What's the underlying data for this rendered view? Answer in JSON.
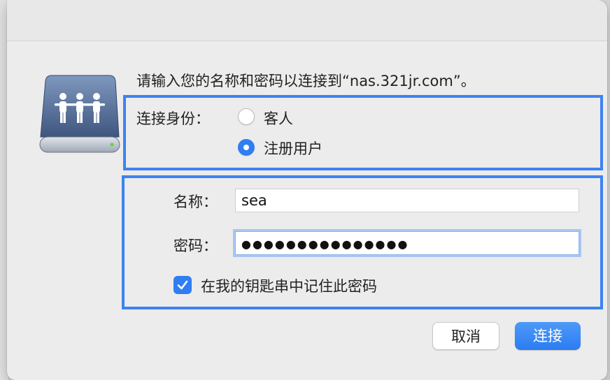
{
  "dialog": {
    "prompt": "请输入您的名称和密码以连接到“nas.321jr.com”。"
  },
  "identity": {
    "label": "连接身份：",
    "options": [
      {
        "label": "客人",
        "selected": false
      },
      {
        "label": "注册用户",
        "selected": true
      }
    ]
  },
  "credentials": {
    "name_label": "名称：",
    "name_value": "sea",
    "password_label": "密码：",
    "password_value": "●●●●●●●●●●●●●●●",
    "remember_label": "在我的钥匙串中记住此密码",
    "remember_checked": true
  },
  "buttons": {
    "cancel": "取消",
    "connect": "连接"
  },
  "colors": {
    "accent": "#2f7ef3",
    "highlight": "#3d83f0"
  },
  "icons": {
    "server": "shared-server-icon",
    "check": "checkmark-icon"
  }
}
